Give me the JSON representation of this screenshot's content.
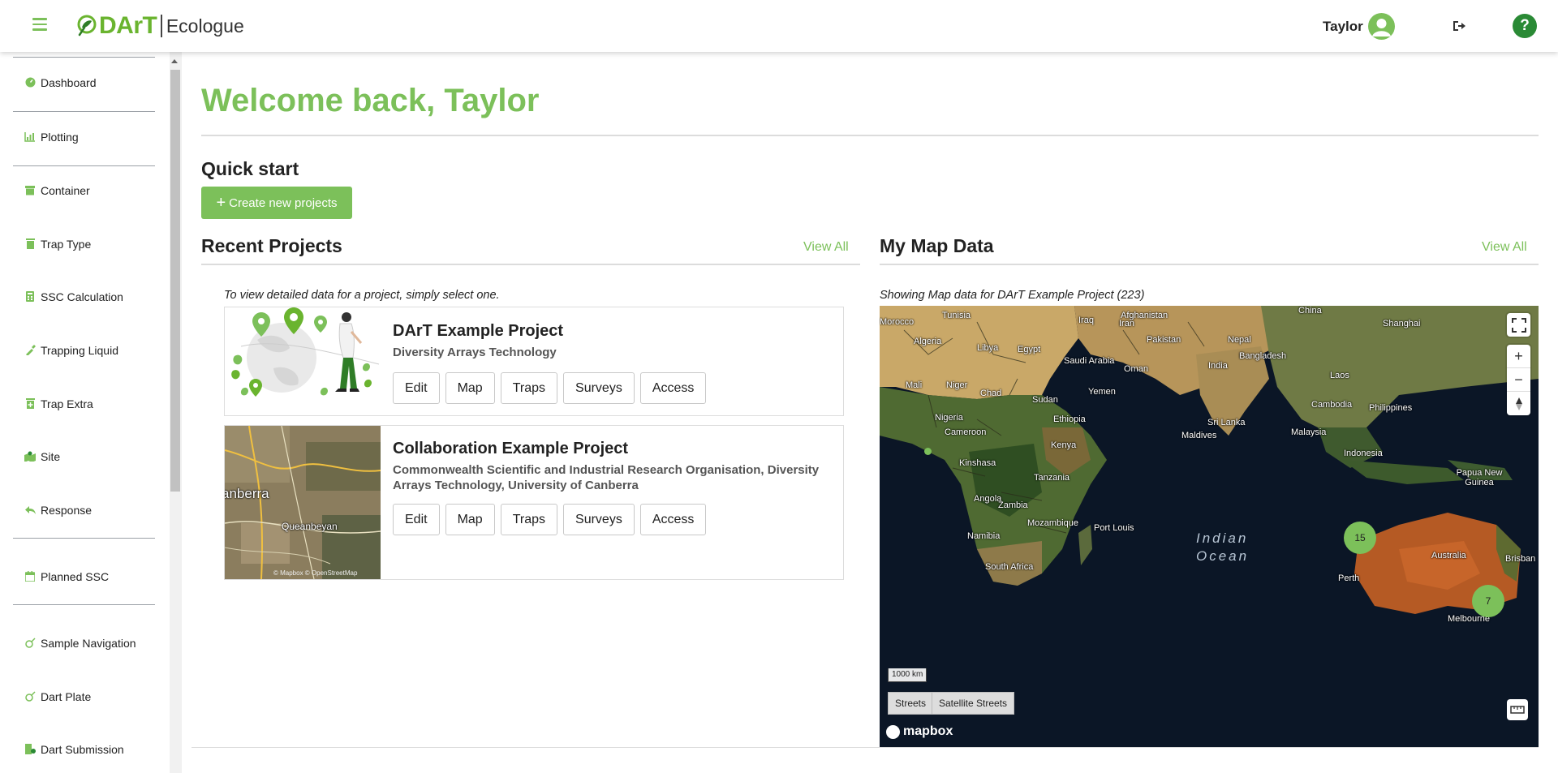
{
  "header": {
    "brand": "DArT",
    "brand_sub": "Ecologue",
    "user_name": "Taylor",
    "help_label": "?"
  },
  "sidebar": {
    "items": [
      {
        "label": "Dashboard",
        "icon": "dashboard-icon"
      },
      {
        "label": "Plotting",
        "icon": "plotting-icon"
      },
      {
        "label": "Container",
        "icon": "container-icon"
      },
      {
        "label": "Trap Type",
        "icon": "trap-type-icon"
      },
      {
        "label": "SSC Calculation",
        "icon": "calculator-icon"
      },
      {
        "label": "Trapping Liquid",
        "icon": "dropper-icon"
      },
      {
        "label": "Trap Extra",
        "icon": "trap-extra-icon"
      },
      {
        "label": "Site",
        "icon": "site-icon"
      },
      {
        "label": "Response",
        "icon": "reply-icon"
      },
      {
        "label": "Planned SSC",
        "icon": "calendar-icon"
      },
      {
        "label": "Sample Navigation",
        "icon": "sample-icon"
      },
      {
        "label": "Dart Plate",
        "icon": "plate-icon"
      },
      {
        "label": "Dart Submission",
        "icon": "submission-icon"
      }
    ]
  },
  "main": {
    "welcome": "Welcome back, Taylor",
    "quick_start": "Quick start",
    "create_button": "Create new projects",
    "recent": {
      "title": "Recent Projects",
      "view_all": "View All",
      "note": "To view detailed data for a project, simply select one.",
      "projects": [
        {
          "title": "DArT Example Project",
          "org": "Diversity Arrays Technology",
          "actions": [
            "Edit",
            "Map",
            "Traps",
            "Surveys",
            "Access"
          ]
        },
        {
          "title": "Collaboration Example Project",
          "org": "Commonwealth Scientific and Industrial Research Organisation, Diversity Arrays Technology, University of Canberra",
          "actions": [
            "Edit",
            "Map",
            "Traps",
            "Surveys",
            "Access"
          ],
          "map_labels": [
            "anberra",
            "Queanbeyan",
            "© Mapbox © OpenStreetMap"
          ]
        }
      ]
    },
    "map": {
      "title": "My Map Data",
      "view_all": "View All",
      "note": "Showing Map data for DArT Example Project (223)",
      "clusters": [
        "15",
        "7"
      ],
      "scale": "1000 km",
      "styles": [
        "Streets",
        "Satellite Streets"
      ],
      "attribution": "mapbox",
      "place_labels": [
        "Morocco",
        "Tunisia",
        "Algeria",
        "Libya",
        "Egypt",
        "Iraq",
        "Iran",
        "Afghanistan",
        "Pakistan",
        "Nepal",
        "China",
        "Shanghai",
        "Saudi Arabia",
        "Oman",
        "India",
        "Bangladesh",
        "Laos",
        "Mali",
        "Niger",
        "Chad",
        "Yemen",
        "Sudan",
        "Cambodia",
        "Philippines",
        "Nigeria",
        "Ethiopia",
        "Sri Lanka",
        "Malaysia",
        "Cameroon",
        "Maldives",
        "Kinshasa",
        "Kenya",
        "Indonesia",
        "Papua New Guinea",
        "Tanzania",
        "Angola",
        "Zambia",
        "Mozambique",
        "Port Louis",
        "Namibia",
        "Australia",
        "South Africa",
        "Perth",
        "Brisban",
        "Melbourne",
        "Indian Ocean"
      ]
    }
  }
}
